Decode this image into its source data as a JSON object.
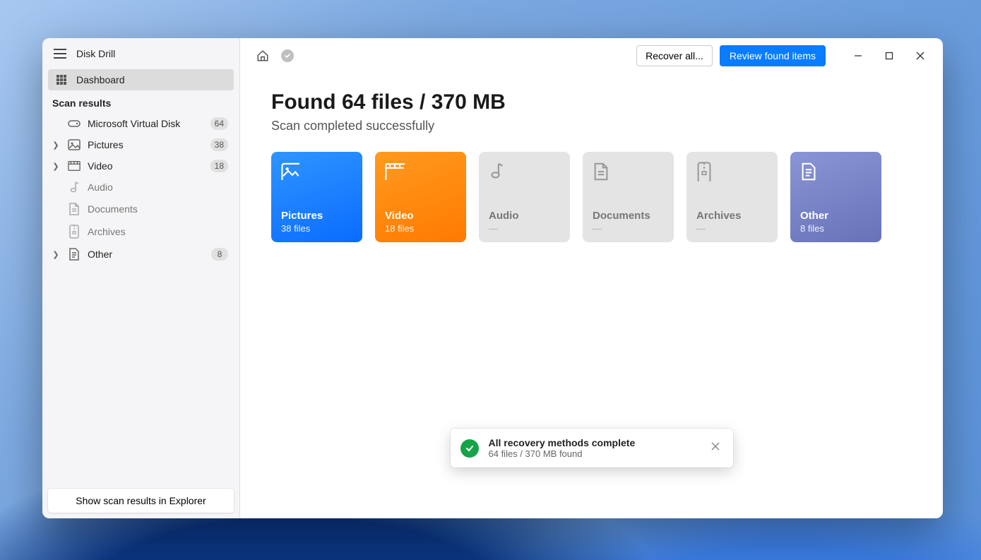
{
  "app": {
    "title": "Disk Drill"
  },
  "sidebar": {
    "dashboard": "Dashboard",
    "section": "Scan results",
    "items": [
      {
        "label": "Microsoft Virtual Disk",
        "count": "64",
        "icon": "disk",
        "expandable": false,
        "dim": false
      },
      {
        "label": "Pictures",
        "count": "38",
        "icon": "pictures",
        "expandable": true,
        "dim": false
      },
      {
        "label": "Video",
        "count": "18",
        "icon": "video",
        "expandable": true,
        "dim": false
      },
      {
        "label": "Audio",
        "count": "",
        "icon": "audio",
        "expandable": false,
        "dim": true
      },
      {
        "label": "Documents",
        "count": "",
        "icon": "documents",
        "expandable": false,
        "dim": true
      },
      {
        "label": "Archives",
        "count": "",
        "icon": "archives",
        "expandable": false,
        "dim": true
      },
      {
        "label": "Other",
        "count": "8",
        "icon": "other",
        "expandable": true,
        "dim": false
      }
    ],
    "footer_button": "Show scan results in Explorer"
  },
  "toolbar": {
    "recover": "Recover all...",
    "review": "Review found items"
  },
  "headline": "Found 64 files / 370 MB",
  "subline": "Scan completed successfully",
  "cards": [
    {
      "title": "Pictures",
      "sub": "38 files",
      "variant": "pictures",
      "icon": "pictures"
    },
    {
      "title": "Video",
      "sub": "18 files",
      "variant": "video",
      "icon": "video"
    },
    {
      "title": "Audio",
      "sub": "—",
      "variant": "disabled",
      "icon": "audio"
    },
    {
      "title": "Documents",
      "sub": "—",
      "variant": "disabled",
      "icon": "documents"
    },
    {
      "title": "Archives",
      "sub": "—",
      "variant": "disabled",
      "icon": "archives"
    },
    {
      "title": "Other",
      "sub": "8 files",
      "variant": "other",
      "icon": "other"
    }
  ],
  "toast": {
    "title": "All recovery methods complete",
    "sub": "64 files / 370 MB found"
  }
}
